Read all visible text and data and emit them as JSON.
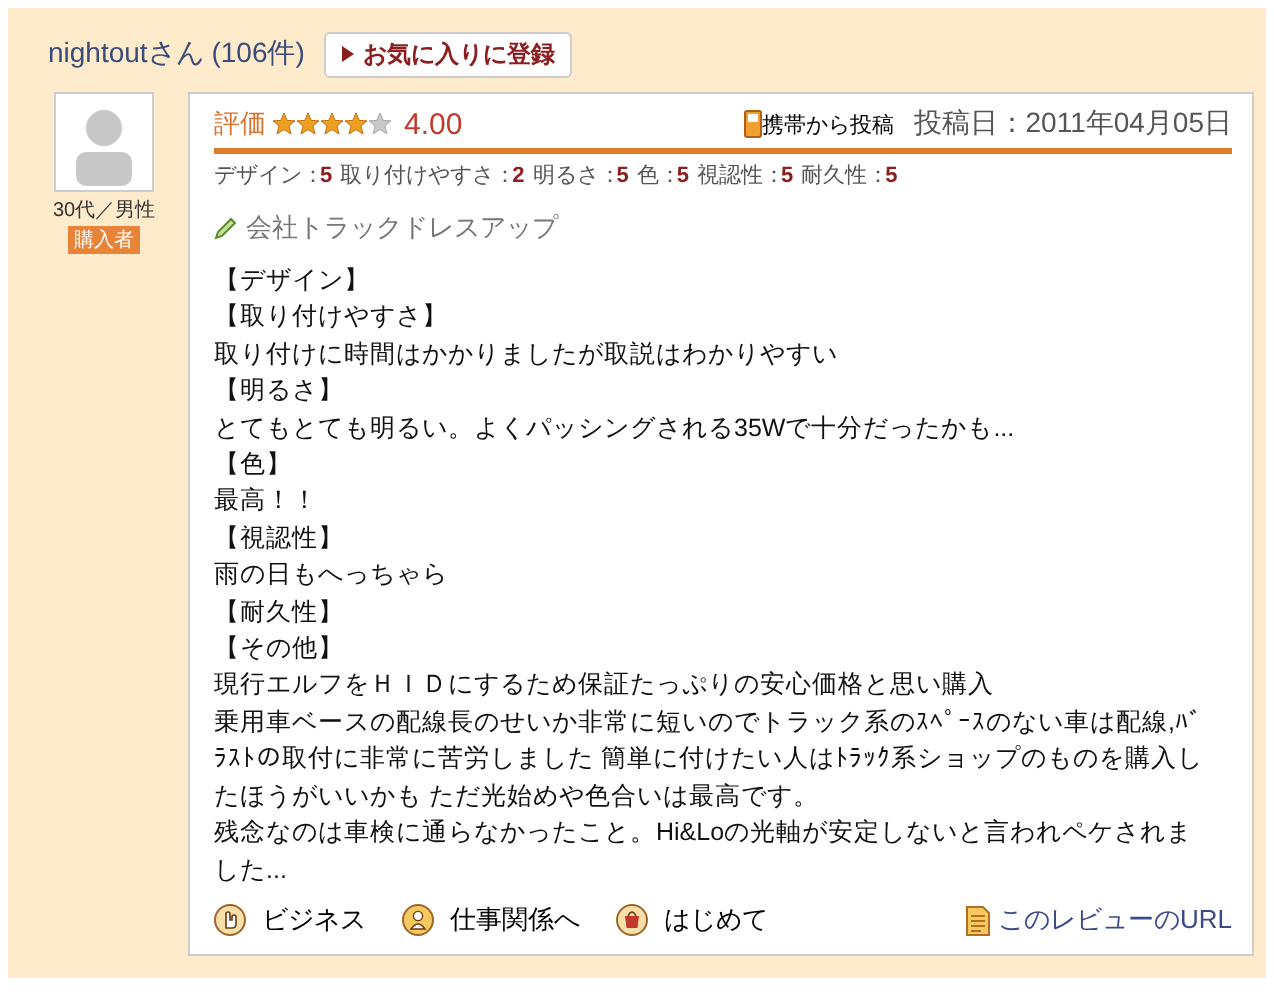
{
  "reviewer": {
    "name": "nightoutさん",
    "count": "(106件)",
    "favorite_button": "お気に入りに登録",
    "profile": "30代／男性",
    "badge": "購入者"
  },
  "review": {
    "rating_label": "評価",
    "stars": 4,
    "score": "4.00",
    "posted_from": "携帯から投稿",
    "posted_date": "投稿日：2011年04月05日",
    "ratings": [
      {
        "label": "デザイン：",
        "value": "5"
      },
      {
        "label": "取り付けやすさ：",
        "value": "2"
      },
      {
        "label": "明るさ：",
        "value": "5"
      },
      {
        "label": "色：",
        "value": "5"
      },
      {
        "label": "視認性：",
        "value": "5"
      },
      {
        "label": "耐久性：",
        "value": "5"
      }
    ],
    "shop": "会社トラックドレスアップ",
    "lines": [
      "【デザイン】",
      "【取り付けやすさ】",
      "取り付けに時間はかかりましたが取説はわかりやすい",
      "【明るさ】",
      "とてもとても明るい。よくパッシングされる35Wで十分だったかも...",
      "【色】",
      "最高！！",
      "【視認性】",
      "雨の日もへっちゃら",
      "【耐久性】",
      "【その他】",
      "現行エルフをＨＩＤにするため保証たっぷりの安心価格と思い購入",
      "乗用車ベースの配線長のせいか非常に短いのでトラック系のｽﾍﾟｰｽのない車は配線,ﾊﾞﾗｽﾄの取付に非常に苦労しました 簡単に付けたい人はﾄﾗｯｸ系ショップのものを購入したほうがいいかも ただ光始めや色合いは最高です。",
      "残念なのは車検に通らなかったこと。Hi&Loの光軸が安定しないと言われペケされました..."
    ],
    "tags": [
      {
        "kind": "hand",
        "label": "ビジネス"
      },
      {
        "kind": "person",
        "label": "仕事関係へ"
      },
      {
        "kind": "bag",
        "label": "はじめて"
      }
    ],
    "url_link": "このレビューのURL"
  }
}
